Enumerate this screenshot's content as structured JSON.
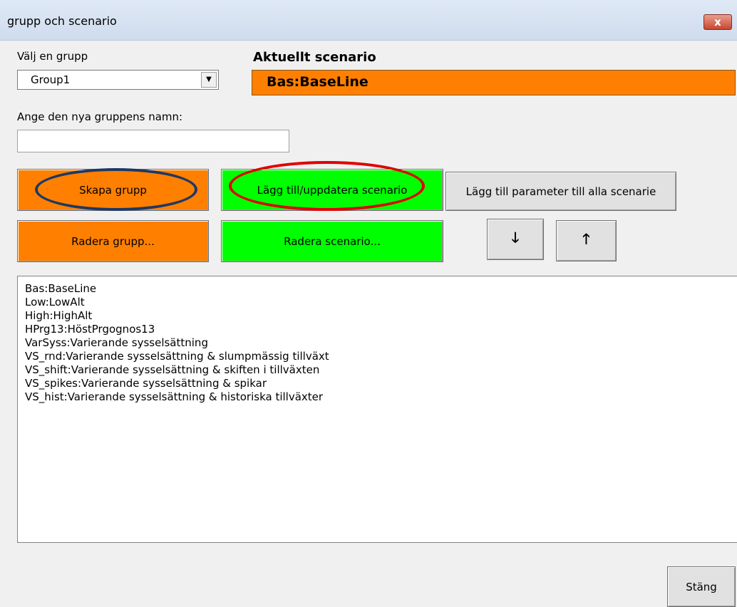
{
  "window": {
    "title": "grupp och scenario",
    "close_label": "x"
  },
  "group_select": {
    "label": "Välj en grupp",
    "value": "Group1",
    "arrow": "▼"
  },
  "current_scenario": {
    "label": "Aktuellt scenario",
    "value": "Bas:BaseLine"
  },
  "new_group": {
    "label": "Ange den nya gruppens namn:",
    "value": ""
  },
  "buttons": {
    "create_group": "Skapa grupp",
    "add_update_scenario": "Lägg till/uppdatera scenario",
    "add_param_all": "Lägg till parameter till alla scenarie",
    "delete_group": "Radera grupp...",
    "delete_scenario": "Radera scenario...",
    "move_down": "🡓",
    "move_up": "🡑",
    "close": "Stäng"
  },
  "scenarios": [
    "Bas:BaseLine",
    "Low:LowAlt",
    "High:HighAlt",
    "HPrg13:HöstPrgognos13",
    "VarSyss:Varierande sysselsättning",
    "VS_rnd:Varierande sysselsättning & slumpmässig tillväxt",
    "VS_shift:Varierande sysselsättning & skiften i tillväxten",
    "VS_spikes:Varierande sysselsättning & spikar",
    "VS_hist:Varierande sysselsättning & historiska tillväxter"
  ],
  "colors": {
    "orange": "#ff8000",
    "green": "#00ff00",
    "annotation_navy": "#1f3864",
    "annotation_red": "#e00000"
  }
}
